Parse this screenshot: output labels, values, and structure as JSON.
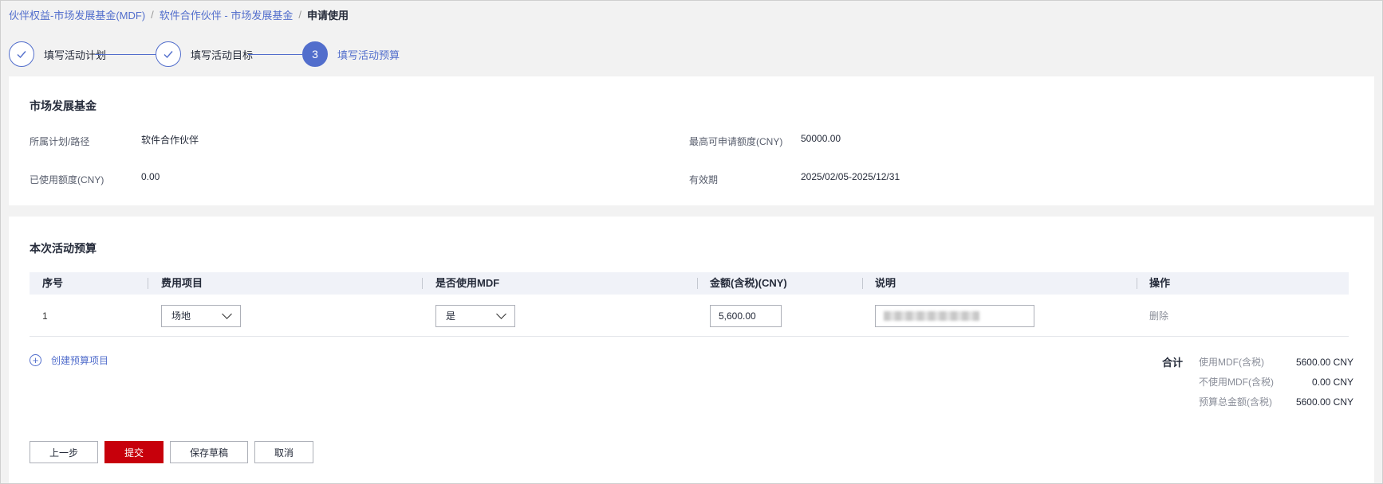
{
  "breadcrumb": {
    "items": [
      "伙伴权益-市场发展基金(MDF)",
      "软件合作伙伴 - 市场发展基金"
    ],
    "current": "申请使用",
    "separator": "/"
  },
  "steps": [
    {
      "label": "填写活动计划",
      "status": "done"
    },
    {
      "label": "填写活动目标",
      "status": "done"
    },
    {
      "label": "填写活动预算",
      "status": "active",
      "number": "3"
    }
  ],
  "fund": {
    "title": "市场发展基金",
    "plan_label": "所属计划/路径",
    "plan_value": "软件合作伙伴",
    "max_label": "最高可申请额度(CNY)",
    "max_value": "50000.00",
    "used_label": "已使用额度(CNY)",
    "used_value": "0.00",
    "validity_label": "有效期",
    "validity_value": "2025/02/05-2025/12/31"
  },
  "budget": {
    "title": "本次活动预算",
    "columns": {
      "index": "序号",
      "item": "费用项目",
      "use_mdf": "是否使用MDF",
      "amount": "金额(含税)(CNY)",
      "desc": "说明",
      "action": "操作"
    },
    "rows": [
      {
        "index": "1",
        "item": "场地",
        "use_mdf": "是",
        "amount": "5,600.00",
        "action": "删除"
      }
    ],
    "add_label": "创建预算项目",
    "summary": {
      "head": "合计",
      "mdf_label": "使用MDF(含税)",
      "mdf_value": "5600.00 CNY",
      "non_mdf_label": "不使用MDF(含税)",
      "non_mdf_value": "0.00 CNY",
      "total_label": "预算总金额(含税)",
      "total_value": "5600.00 CNY"
    }
  },
  "buttons": {
    "prev": "上一步",
    "submit": "提交",
    "save_draft": "保存草稿",
    "cancel": "取消"
  },
  "colors": {
    "accent": "#526ecc",
    "primary_button": "#c7000b"
  }
}
